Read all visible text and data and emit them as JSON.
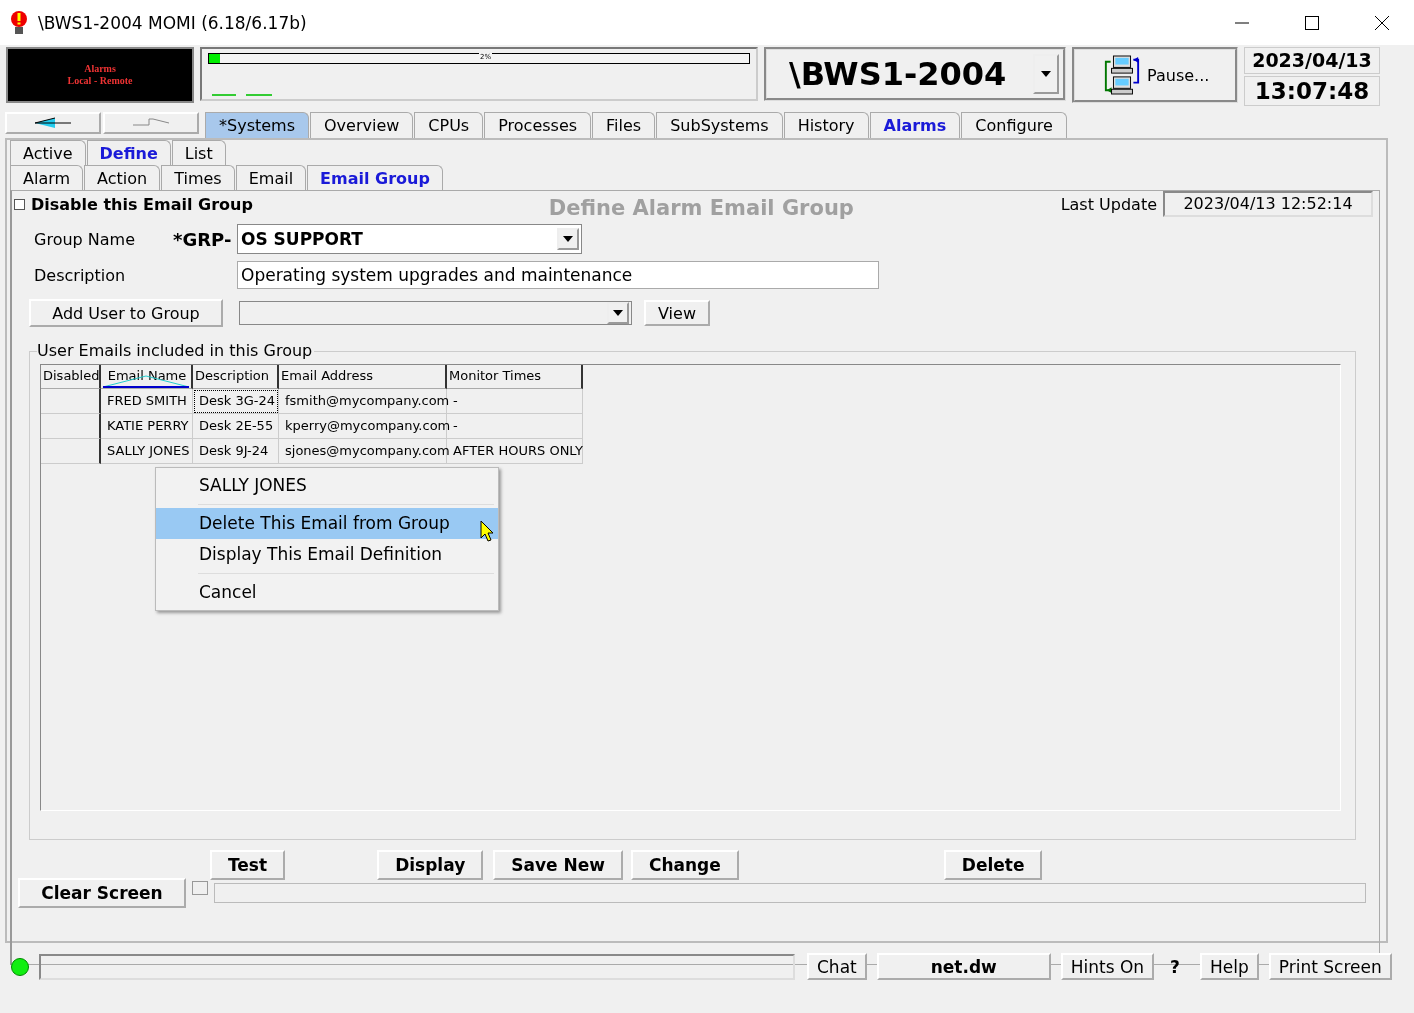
{
  "window": {
    "title": "\\BWS1-2004 MOMI (6.18/6.17b)"
  },
  "alarm_panel": {
    "line_1": "Alarms",
    "line_2": "Local - Remote"
  },
  "progress": {
    "reading": "2%",
    "level": 0.02
  },
  "system_selector": {
    "value": "\\BWS1-2004"
  },
  "pause_button": {
    "label": "Pause..."
  },
  "date": "2023/04/13",
  "time": "13:07:48",
  "main_tabs": [
    {
      "label": "*Systems",
      "selected": false,
      "highlighted": true
    },
    {
      "label": "Overview",
      "selected": false,
      "highlighted": false
    },
    {
      "label": "CPUs",
      "selected": false,
      "highlighted": false
    },
    {
      "label": "Processes",
      "selected": false,
      "highlighted": false
    },
    {
      "label": "Files",
      "selected": false,
      "highlighted": false
    },
    {
      "label": "SubSystems",
      "selected": false,
      "highlighted": false
    },
    {
      "label": "History",
      "selected": false,
      "highlighted": false
    },
    {
      "label": "Alarms",
      "selected": true,
      "highlighted": false
    },
    {
      "label": "Configure",
      "selected": false,
      "highlighted": false
    }
  ],
  "alarm_tabs": [
    {
      "label": "Active",
      "selected": false
    },
    {
      "label": "Define",
      "selected": true
    },
    {
      "label": "List",
      "selected": false
    }
  ],
  "define_tabs": [
    {
      "label": "Alarm",
      "selected": false
    },
    {
      "label": "Action",
      "selected": false
    },
    {
      "label": "Times",
      "selected": false
    },
    {
      "label": "Email",
      "selected": false
    },
    {
      "label": "Email Group",
      "selected": true
    }
  ],
  "form": {
    "disable_checkbox": {
      "label": "Disable this Email Group",
      "checked": false
    },
    "heading": "Define Alarm Email Group",
    "last_update_label": "Last Update",
    "last_update": "2023/04/13 12:52:14",
    "group_name_label": "Group Name",
    "group_prefix": "*GRP-",
    "group_name": "OS SUPPORT",
    "description_label": "Description",
    "description": "Operating system upgrades and maintenance",
    "add_user_button": "Add User to Group",
    "view_button": "View"
  },
  "emails_group": {
    "title": "User Emails included in this Group",
    "columns": [
      {
        "label": "Disabled",
        "sorted": false
      },
      {
        "label": "Email Name",
        "sorted": true
      },
      {
        "label": "Description",
        "sorted": false
      },
      {
        "label": "Email Address",
        "sorted": false
      },
      {
        "label": "Monitor Times",
        "sorted": false
      }
    ],
    "rows": [
      {
        "disabled": "",
        "name": "FRED SMITH",
        "description": "Desk 3G-24",
        "address": "fsmith@mycompany.com",
        "monitor_times": "-",
        "focused": true
      },
      {
        "disabled": "",
        "name": "KATIE PERRY",
        "description": "Desk 2E-55",
        "address": "kperry@mycompany.com",
        "monitor_times": "-",
        "focused": false
      },
      {
        "disabled": "",
        "name": "SALLY JONES",
        "description": "Desk 9J-24",
        "address": "sjones@mycompany.com",
        "monitor_times": "AFTER HOURS ONLY",
        "focused": false
      }
    ]
  },
  "context_menu": {
    "items": [
      {
        "kind": "header",
        "label": "SALLY JONES"
      },
      {
        "kind": "separator"
      },
      {
        "kind": "action",
        "label": "Delete This Email from Group",
        "highlighted": true
      },
      {
        "kind": "action",
        "label": "Display This Email Definition",
        "highlighted": false
      },
      {
        "kind": "separator"
      },
      {
        "kind": "action",
        "label": "Cancel",
        "highlighted": false
      }
    ]
  },
  "action_buttons": [
    "Test",
    "Display",
    "Save New",
    "Change",
    "Delete"
  ],
  "clear_button": "Clear Screen",
  "message_checkbox": {
    "checked": false
  },
  "status_bar": {
    "online": true,
    "buttons": [
      {
        "kind": "button",
        "label": "Chat"
      },
      {
        "kind": "wide",
        "label": "net.dw"
      },
      {
        "kind": "button",
        "label": "Hints On"
      },
      {
        "kind": "plain",
        "label": "?"
      },
      {
        "kind": "button",
        "label": "Help"
      },
      {
        "kind": "button",
        "label": "Print Screen"
      }
    ]
  }
}
